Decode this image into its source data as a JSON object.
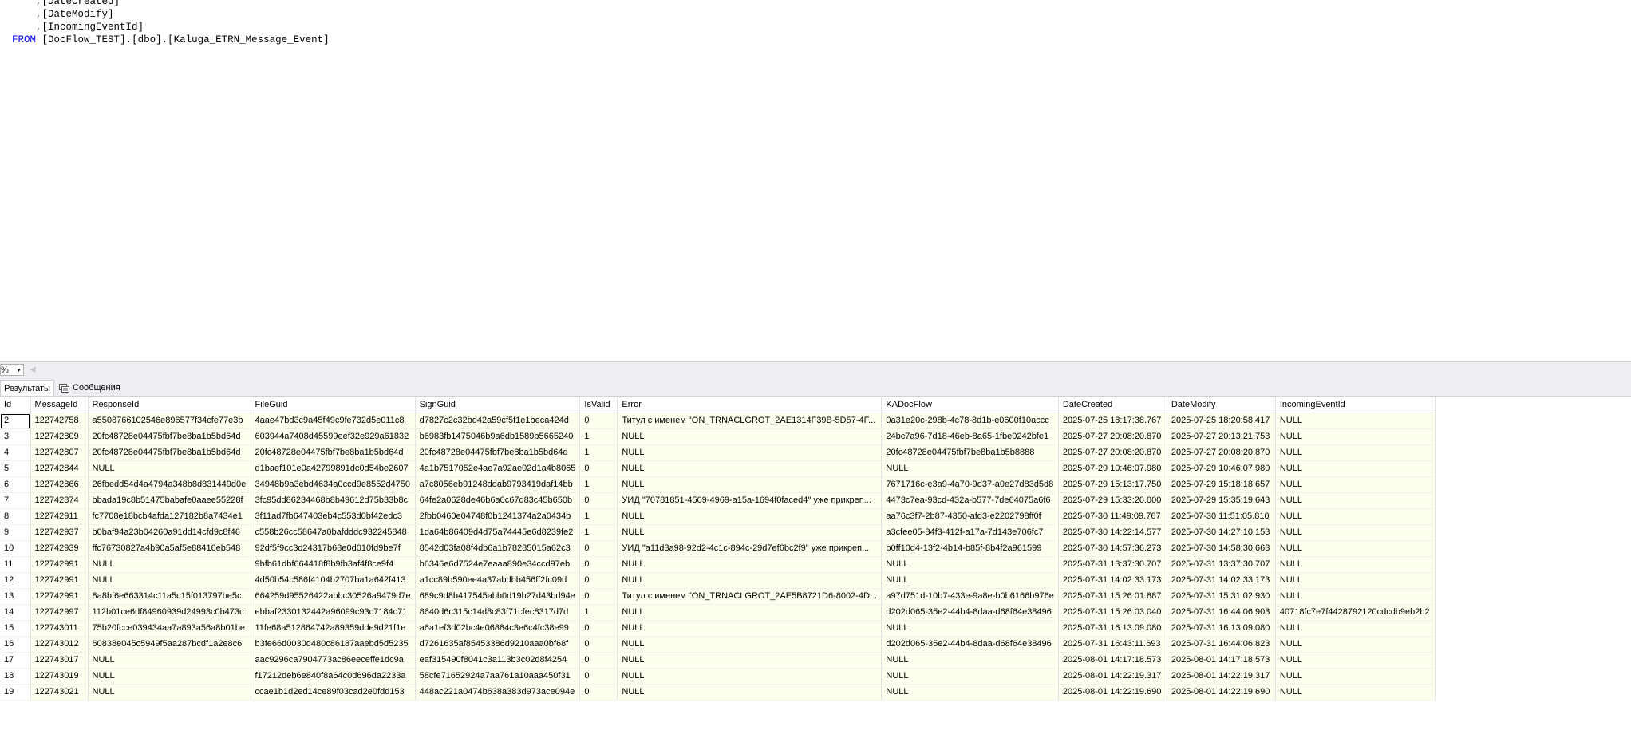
{
  "editor": {
    "lines": [
      {
        "indent": "      ",
        "comma": ",",
        "text": "[DateCreated]"
      },
      {
        "indent": "      ",
        "comma": ",",
        "text": "[DateModify]"
      },
      {
        "indent": "      ",
        "comma": ",",
        "text": "[IncomingEventId]"
      }
    ],
    "from_keyword": "FROM",
    "from_target": "[DocFlow_TEST].[dbo].[Kaluga_ETRN_Message_Event]"
  },
  "zoom": {
    "value": "%"
  },
  "tabs": {
    "results": "Результаты",
    "messages": "Сообщения"
  },
  "grid": {
    "columns": [
      "Id",
      "MessageId",
      "ResponseId",
      "FileGuid",
      "SignGuid",
      "IsValid",
      "Error",
      "KADocFlow",
      "DateCreated",
      "DateModify",
      "IncomingEventId"
    ],
    "rows": [
      [
        "2",
        "122742758",
        "a5508766102546e896577f34cfe77e3b",
        "4aae47bd3c9a45f49c9fe732d5e011c8",
        "d7827c2c32bd42a59cf5f1e1beca424d",
        "0",
        "Титул с именем \"ON_TRNACLGROT_2AE1314F39B-5D57-4F...",
        "0a31e20c-298b-4c78-8d1b-e0600f10accc",
        "2025-07-25 18:17:38.767",
        "2025-07-25 18:20:58.417",
        "NULL"
      ],
      [
        "3",
        "122742809",
        "20fc48728e04475fbf7be8ba1b5bd64d",
        "603944a7408d45599eef32e929a61832",
        "b6983fb1475046b9a6db1589b5665240",
        "1",
        "NULL",
        "24bc7a96-7d18-46eb-8a65-1fbe0242bfe1",
        "2025-07-27 20:08:20.870",
        "2025-07-27 20:13:21.753",
        "NULL"
      ],
      [
        "4",
        "122742807",
        "20fc48728e04475fbf7be8ba1b5bd64d",
        "20fc48728e04475fbf7be8ba1b5bd64d",
        "20fc48728e04475fbf7be8ba1b5bd64d",
        "1",
        "NULL",
        "20fc48728e04475fbf7be8ba1b5b8888",
        "2025-07-27 20:08:20.870",
        "2025-07-27 20:08:20.870",
        "NULL"
      ],
      [
        "5",
        "122742844",
        "NULL",
        "d1baef101e0a42799891dc0d54be2607",
        "4a1b7517052e4ae7a92ae02d1a4b8065",
        "0",
        "NULL",
        "NULL",
        "2025-07-29 10:46:07.980",
        "2025-07-29 10:46:07.980",
        "NULL"
      ],
      [
        "6",
        "122742866",
        "26fbedd54d4a4794a348b8d831449d0e",
        "34948b9a3ebd4634a0ccd9e8552d4750",
        "a7c8056eb91248ddab9793419daf14bb",
        "1",
        "NULL",
        "7671716c-e3a9-4a70-9d37-a0e27d83d5d8",
        "2025-07-29 15:13:17.750",
        "2025-07-29 15:18:18.657",
        "NULL"
      ],
      [
        "7",
        "122742874",
        "bbada19c8b51475babafe0aaee55228f",
        "3fc95dd86234468b8b49612d75b33b8c",
        "64fe2a0628de46b6a0c67d83c45b650b",
        "0",
        "УИД \"70781851-4509-4969-a15a-1694f0faced4\" уже прикреп...",
        "4473c7ea-93cd-432a-b577-7de64075a6f6",
        "2025-07-29 15:33:20.000",
        "2025-07-29 15:35:19.643",
        "NULL"
      ],
      [
        "8",
        "122742911",
        "fc7708e18bcb4afda127182b8a7434e1",
        "3f11ad7fb647403eb4c553d0bf42edc3",
        "2fbb0460e04748f0b1241374a2a0434b",
        "1",
        "NULL",
        "aa76c3f7-2b87-4350-afd3-e2202798ff0f",
        "2025-07-30 11:49:09.767",
        "2025-07-30 11:51:05.810",
        "NULL"
      ],
      [
        "9",
        "122742937",
        "b0baf94a23b04260a91dd14cfd9c8f46",
        "c558b26cc58647a0bafdddc932245848",
        "1da64b86409d4d75a74445e6d8239fe2",
        "1",
        "NULL",
        "a3cfee05-84f3-412f-a17a-7d143e706fc7",
        "2025-07-30 14:22:14.577",
        "2025-07-30 14:27:10.153",
        "NULL"
      ],
      [
        "10",
        "122742939",
        "ffc76730827a4b90a5af5e88416eb548",
        "92df5f9cc3d24317b68e0d010fd9be7f",
        "8542d03fa08f4db6a1b78285015a62c3",
        "0",
        "УИД \"a11d3a98-92d2-4c1c-894c-29d7ef6bc2f9\" уже прикреп...",
        "b0ff10d4-13f2-4b14-b85f-8b4f2a961599",
        "2025-07-30 14:57:36.273",
        "2025-07-30 14:58:30.663",
        "NULL"
      ],
      [
        "11",
        "122742991",
        "NULL",
        "9bfb61dbf664418f8b9fb3af4f8ce9f4",
        "b6346e6d7524e7eaaa890e34ccd97eb",
        "0",
        "NULL",
        "NULL",
        "2025-07-31 13:37:30.707",
        "2025-07-31 13:37:30.707",
        "NULL"
      ],
      [
        "12",
        "122742991",
        "NULL",
        "4d50b54c586f4104b2707ba1a642f413",
        "a1cc89b590ee4a37abdbb456ff2fc09d",
        "0",
        "NULL",
        "NULL",
        "2025-07-31 14:02:33.173",
        "2025-07-31 14:02:33.173",
        "NULL"
      ],
      [
        "13",
        "122742991",
        "8a8bf6e663314c11a5c15f013797be5c",
        "664259d95526422abbc30526a9479d7e",
        "689c9d8b417545abb0d19b27d43bd94e",
        "0",
        "Титул с именем \"ON_TRNACLGROT_2AE5B8721D6-8002-4D...",
        "a97d751d-10b7-433e-9a8e-b0b6166b976e",
        "2025-07-31 15:26:01.887",
        "2025-07-31 15:31:02.930",
        "NULL"
      ],
      [
        "14",
        "122742997",
        "112b01ce6df84960939d24993c0b473c",
        "ebbaf2330132442a96099c93c7184c71",
        "8640d6c315c14d8c83f71cfec8317d7d",
        "1",
        "NULL",
        "d202d065-35e2-44b4-8daa-d68f64e38496",
        "2025-07-31 15:26:03.040",
        "2025-07-31 16:44:06.903",
        "40718fc7e7f4428792120cdcdb9eb2b2"
      ],
      [
        "15",
        "122743011",
        "75b20fcce039434aa7a893a56a8b01be",
        "11fe68a512864742a89359dde9d21f1e",
        "a6a1ef3d02bc4e06884c3e6c4fc38e99",
        "0",
        "NULL",
        "NULL",
        "2025-07-31 16:13:09.080",
        "2025-07-31 16:13:09.080",
        "NULL"
      ],
      [
        "16",
        "122743012",
        "60838e045c5949f5aa287bcdf1a2e8c6",
        "b3fe66d0030d480c86187aaebd5d5235",
        "d7261635af85453386d9210aaa0bf68f",
        "0",
        "NULL",
        "d202d065-35e2-44b4-8daa-d68f64e38496",
        "2025-07-31 16:43:11.693",
        "2025-07-31 16:44:06.823",
        "NULL"
      ],
      [
        "17",
        "122743017",
        "NULL",
        "aac9296ca7904773ac86eeceffe1dc9a",
        "eaf315490f8041c3a113b3c02d8f4254",
        "0",
        "NULL",
        "NULL",
        "2025-08-01 14:17:18.573",
        "2025-08-01 14:17:18.573",
        "NULL"
      ],
      [
        "18",
        "122743019",
        "NULL",
        "f17212deb6e840f8a64c0d696da2233a",
        "58cfe71652924a7aa761a10aaa450f31",
        "0",
        "NULL",
        "NULL",
        "2025-08-01 14:22:19.317",
        "2025-08-01 14:22:19.317",
        "NULL"
      ],
      [
        "19",
        "122743021",
        "NULL",
        "ccae1b1d2ed14ce89f03cad2e0fdd153",
        "448ac221a0474b638a383d973ace094e",
        "0",
        "NULL",
        "NULL",
        "2025-08-01 14:22:19.690",
        "2025-08-01 14:22:19.690",
        "NULL"
      ]
    ]
  }
}
